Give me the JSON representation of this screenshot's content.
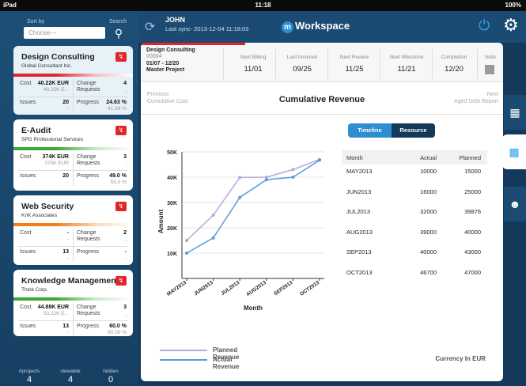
{
  "status_bar": {
    "device": "iPad",
    "time": "11:18",
    "battery": "100%"
  },
  "sidebar": {
    "sort_label": "Sort by",
    "sort_placeholder": "Choose---",
    "search_label": "Search",
    "projects": [
      {
        "name": "Design Consulting",
        "client": "Global Consultant Inc.",
        "bar_color": "#e1252b",
        "bar_color2": "#f6c3c4",
        "cost_label": "Cost",
        "cost": "40.22K EUR",
        "cost_sub": "40.25K E...",
        "change_label": "Change Requests",
        "change": "4",
        "change_sub": "-",
        "issues_label": "Issues",
        "issues": "20",
        "issues_sub": "-",
        "progress_label": "Progress",
        "progress": "24.63 %",
        "progress_sub": "41.99 %"
      },
      {
        "name": "E-Audit",
        "client": "SPG Professional Services",
        "bar_color": "#3aaa35",
        "bar_color2": "#cfe9ce",
        "cost_label": "Cost",
        "cost": "374K EUR",
        "cost_sub": "375K EUR",
        "change_label": "Change Requests",
        "change": "3",
        "change_sub": "-",
        "issues_label": "Issues",
        "issues": "20",
        "issues_sub": "-",
        "progress_label": "Progress",
        "progress": "49.0 %",
        "progress_sub": "55.0 %"
      },
      {
        "name": "Web Security",
        "client": "KnK Associates",
        "bar_color": "#f07f1a",
        "bar_color2": "#fbd9b8",
        "cost_label": "Cost",
        "cost": "-",
        "cost_sub": "-",
        "change_label": "Change Requests",
        "change": "2",
        "change_sub": "-",
        "issues_label": "Issues",
        "issues": "13",
        "issues_sub": "-",
        "progress_label": "Progress",
        "progress": "-",
        "progress_sub": "-"
      },
      {
        "name": "Knowledge Management",
        "client": "Think Corp.",
        "bar_color": "#3aaa35",
        "bar_color2": "#cfe9ce",
        "cost_label": "Cost",
        "cost": "44.88K EUR",
        "cost_sub": "53.22K E...",
        "change_label": "Change Requests",
        "change": "3",
        "change_sub": "-",
        "issues_label": "Issues",
        "issues": "13",
        "issues_sub": "-",
        "progress_label": "Progress",
        "progress": "60.0 %",
        "progress_sub": "80.00 %"
      }
    ],
    "footer": {
      "projects_label": "#projects",
      "projects": "4",
      "viewable_label": "viewable",
      "viewable": "4",
      "hidden_label": "hidden",
      "hidden": "0"
    }
  },
  "topbar": {
    "user": "JOHN",
    "last_sync": "Last sync- 2013-12-04 11:18:03",
    "workspace_title": "Workspace",
    "logo_letter": "m"
  },
  "summary": {
    "project_name": "Design Consulting",
    "project_id": "I/0004",
    "dates": "01/07 - 12/20",
    "type": "Master Project",
    "next_billing_label": "Next Billing",
    "next_billing": "11/01",
    "last_invoiced_label": "Last Invoiced",
    "last_invoiced": "09/25",
    "next_review_label": "Next Review",
    "next_review": "11/25",
    "next_milestone_label": "Next Milestone",
    "next_milestone": "11/21",
    "completion_label": "Completion",
    "completion": "12/20",
    "note_label": "Note"
  },
  "report_nav": {
    "prev_label": "Previous",
    "prev": "Cumulative Cost",
    "title": "Cumulative Revenue",
    "next_label": "Next",
    "next": "Aged Debt Report"
  },
  "toggle": {
    "timeline": "Timeline",
    "resource": "Resource"
  },
  "chart_data": {
    "type": "line",
    "categories": [
      "MAY2013",
      "JUN2013",
      "JUL2013",
      "AUG2013",
      "SEP2013",
      "OCT2013"
    ],
    "series": [
      {
        "name": "Planned Revenue",
        "color": "#b8a6dc",
        "values": [
          15000,
          25000,
          39876,
          40000,
          43000,
          47000
        ]
      },
      {
        "name": "Actual Revenue",
        "color": "#5b9bd8",
        "values": [
          10000,
          16000,
          32000,
          39000,
          40000,
          46700
        ]
      }
    ],
    "xlabel": "Month",
    "ylabel": "Amount",
    "yticks": [
      "10K",
      "20K",
      "30K",
      "40K",
      "50K"
    ],
    "ylim": [
      0,
      50000
    ],
    "grid": true
  },
  "table": {
    "headers": [
      "Month",
      "Actual",
      "Planned"
    ],
    "rows": [
      [
        "MAY2013",
        "10000",
        "15000"
      ],
      [
        "JUN2013",
        "16000",
        "25000"
      ],
      [
        "JUL2013",
        "32000",
        "39876"
      ],
      [
        "AUG2013",
        "39000",
        "40000"
      ],
      [
        "SEP2013",
        "40000",
        "43000"
      ],
      [
        "OCT2013",
        "46700",
        "47000"
      ]
    ]
  },
  "legend": {
    "planned": "Planned Revenue",
    "actual": "Actual Revenue",
    "currency": "Currency In EUR"
  },
  "side_tabs": [
    "dashboard-icon",
    "bar-chart-icon",
    "person-icon"
  ]
}
